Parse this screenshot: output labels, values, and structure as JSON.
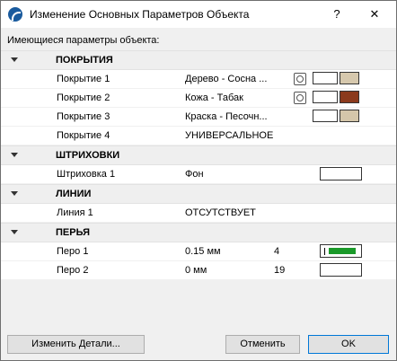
{
  "window": {
    "title": "Изменение Основных Параметров Объекта",
    "help_label": "?",
    "close_label": "✕"
  },
  "section_label": "Имеющиеся параметры объекта:",
  "groups": {
    "surfaces": {
      "label": "ПОКРЫТИЯ",
      "rows": [
        {
          "name": "Покрытие 1",
          "value": "Дерево - Сосна ...",
          "color": "#d6c8ad"
        },
        {
          "name": "Покрытие 2",
          "value": "Кожа - Табак",
          "color": "#8b3a1c"
        },
        {
          "name": "Покрытие 3",
          "value": "Краска - Песочн...",
          "color": "#d4c6aa"
        },
        {
          "name": "Покрытие 4",
          "value": "УНИВЕРСАЛЬНОЕ"
        }
      ]
    },
    "hatches": {
      "label": "ШТРИХОВКИ",
      "rows": [
        {
          "name": "Штриховка 1",
          "value": "Фон"
        }
      ]
    },
    "lines": {
      "label": "ЛИНИИ",
      "rows": [
        {
          "name": "Линия 1",
          "value": "ОТСУТСТВУЕТ"
        }
      ]
    },
    "pens": {
      "label": "ПЕРЬЯ",
      "rows": [
        {
          "name": "Перо 1",
          "value": "0.15 мм",
          "number": "4",
          "color": "#1a9a2a"
        },
        {
          "name": "Перо 2",
          "value": "0 мм",
          "number": "19"
        }
      ]
    }
  },
  "buttons": {
    "details": "Изменить Детали...",
    "cancel": "Отменить",
    "ok": "OK"
  }
}
